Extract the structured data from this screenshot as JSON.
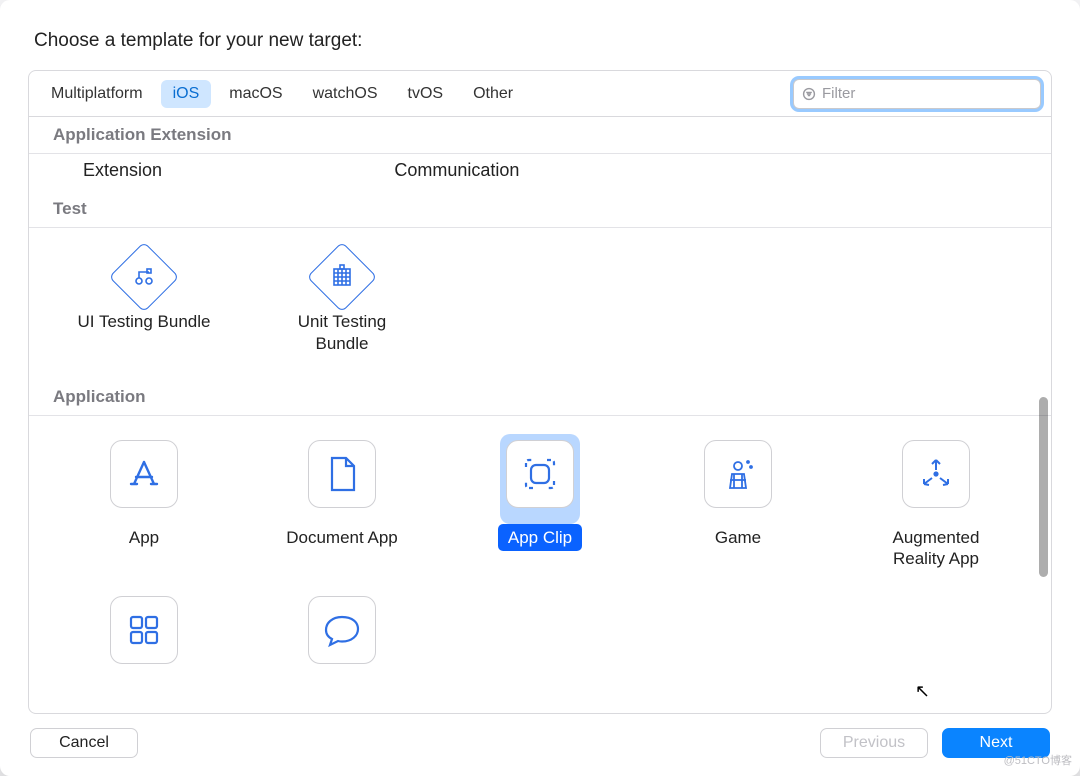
{
  "prompt": "Choose a template for your new target:",
  "tabs": {
    "items": [
      "Multiplatform",
      "iOS",
      "macOS",
      "watchOS",
      "tvOS",
      "Other"
    ],
    "selected": "iOS"
  },
  "filter": {
    "placeholder": "Filter",
    "value": ""
  },
  "sections": {
    "app_extension": {
      "header": "Application Extension",
      "columns": [
        "Extension",
        "Communication"
      ]
    },
    "test": {
      "header": "Test",
      "items": [
        {
          "label": "UI Testing Bundle",
          "icon": "ui-testing-icon"
        },
        {
          "label": "Unit Testing\nBundle",
          "icon": "unit-testing-icon"
        }
      ]
    },
    "application": {
      "header": "Application",
      "items": [
        {
          "label": "App",
          "icon": "app-icon",
          "selected": false
        },
        {
          "label": "Document App",
          "icon": "document-icon",
          "selected": false
        },
        {
          "label": "App Clip",
          "icon": "app-clip-icon",
          "selected": true
        },
        {
          "label": "Game",
          "icon": "game-icon",
          "selected": false
        },
        {
          "label": "Augmented\nReality App",
          "icon": "ar-icon",
          "selected": false
        },
        {
          "label": "",
          "icon": "grid-icon",
          "selected": false
        },
        {
          "label": "",
          "icon": "message-icon",
          "selected": false
        }
      ]
    }
  },
  "footer": {
    "cancel": "Cancel",
    "previous": "Previous",
    "next": "Next"
  },
  "watermark": "@51CTO博客"
}
